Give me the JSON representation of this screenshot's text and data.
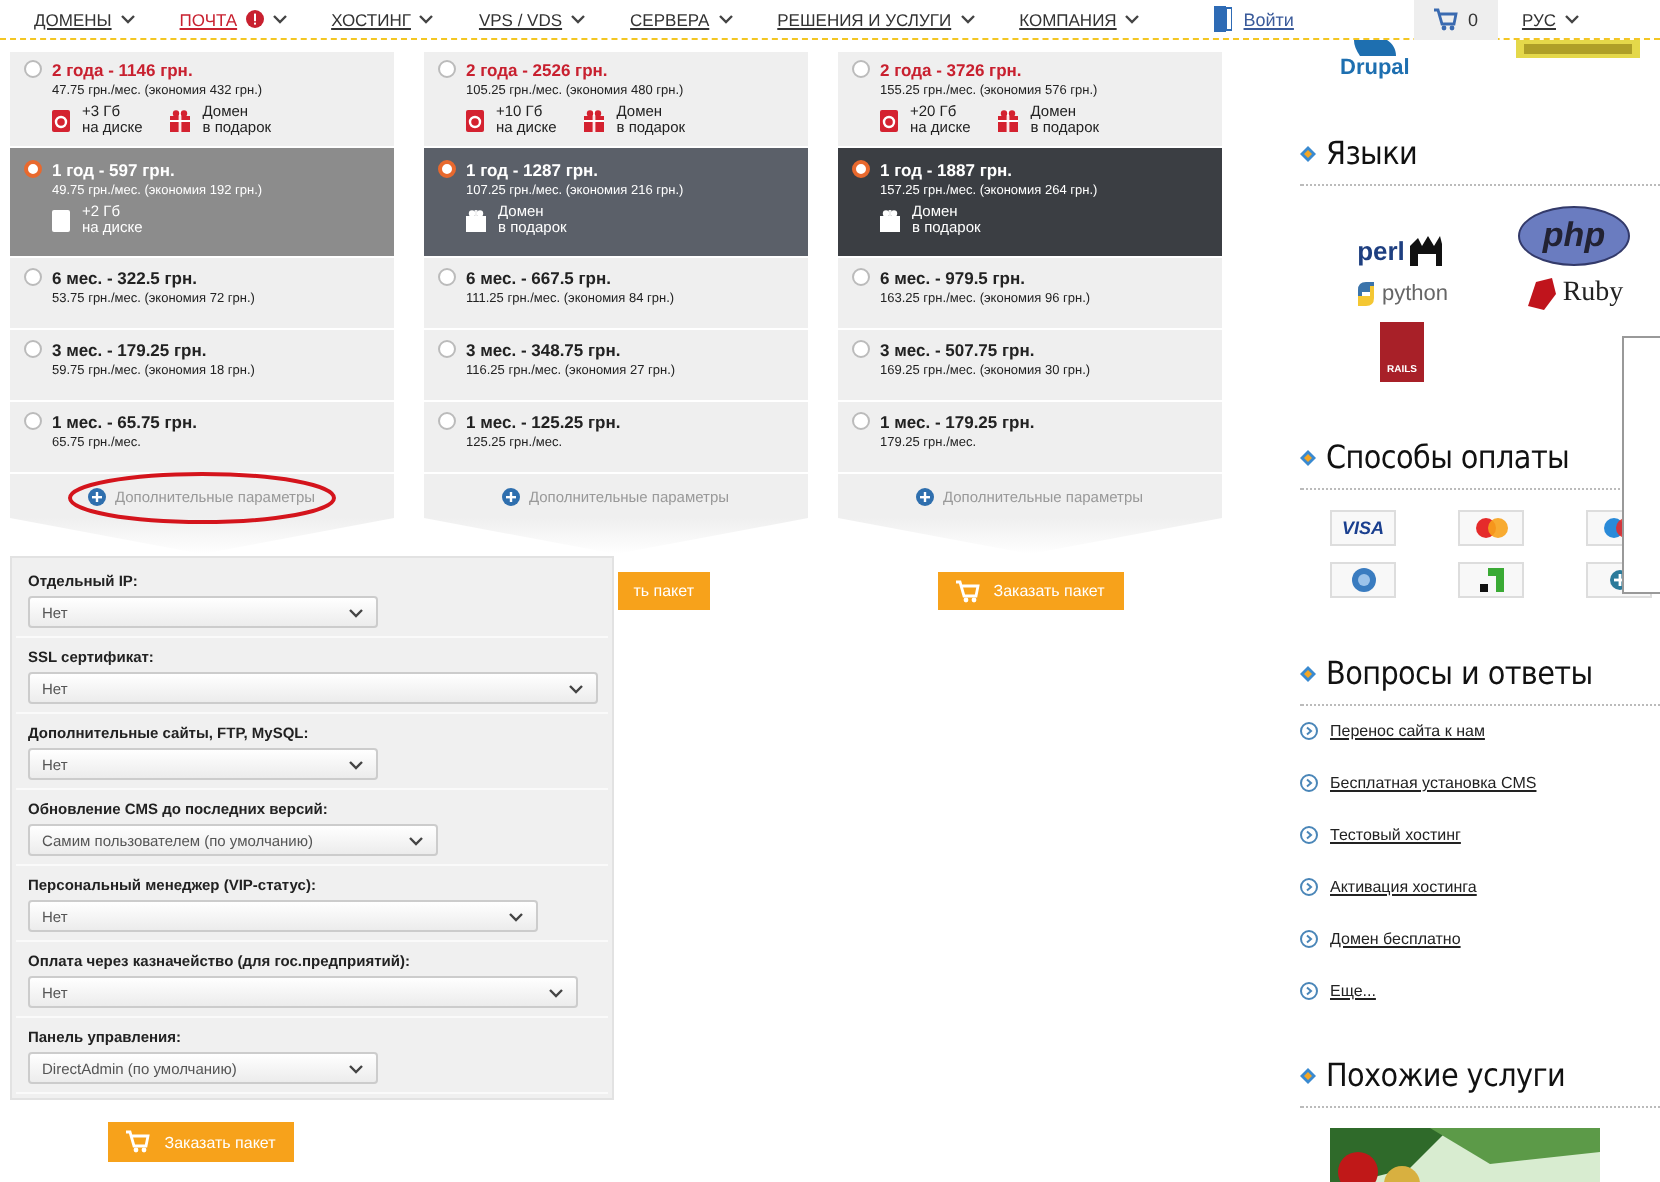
{
  "nav": {
    "items": [
      {
        "label": "ДОМЕНЫ",
        "alert": false
      },
      {
        "label": "ПОЧТА",
        "alert": true
      },
      {
        "label": "ХОСТИНГ",
        "alert": false
      },
      {
        "label": "VPS / VDS",
        "alert": false
      },
      {
        "label": "СЕРВЕРА",
        "alert": false
      },
      {
        "label": "РЕШЕНИЯ И УСЛУГИ",
        "alert": false
      },
      {
        "label": "КОМПАНИЯ",
        "alert": false
      }
    ],
    "login": "Войти",
    "cart_count": "0",
    "language": "РУС"
  },
  "plans": [
    {
      "color": "#8c8c8c",
      "more": "Дополнительные параметры",
      "options": [
        {
          "title": "2 года - 1146 грн.",
          "accent": true,
          "selected": false,
          "price": "47.75 грн./мес. (экономия 432 грн.)",
          "perks": [
            {
              "kind": "disk",
              "value": "+3 Гб",
              "caption": "на диске"
            },
            {
              "kind": "gift",
              "value": "Домен",
              "caption": "в подарок"
            }
          ]
        },
        {
          "title": "1 год - 597 грн.",
          "accent": false,
          "selected": true,
          "price": "49.75 грн./мес. (экономия 192 грн.)",
          "perks": [
            {
              "kind": "disk",
              "value": "+2 Гб",
              "caption": "на диске"
            }
          ]
        },
        {
          "title": "6 мес. - 322.5 грн.",
          "accent": false,
          "selected": false,
          "price": "53.75 грн./мес. (экономия 72 грн.)"
        },
        {
          "title": "3 мес. - 179.25 грн.",
          "accent": false,
          "selected": false,
          "price": "59.75 грн./мес. (экономия 18 грн.)"
        },
        {
          "title": "1 мес. - 65.75 грн.",
          "accent": false,
          "selected": false,
          "price": "65.75 грн./мес."
        }
      ]
    },
    {
      "color": "#5b6069",
      "more": "Дополнительные параметры",
      "order": "ть пакет",
      "options": [
        {
          "title": "2 года - 2526 грн.",
          "accent": true,
          "selected": false,
          "price": "105.25 грн./мес. (экономия 480 грн.)",
          "perks": [
            {
              "kind": "disk",
              "value": "+10 Гб",
              "caption": "на диске"
            },
            {
              "kind": "gift",
              "value": "Домен",
              "caption": "в подарок"
            }
          ]
        },
        {
          "title": "1 год - 1287 грн.",
          "accent": false,
          "selected": true,
          "price": "107.25 грн./мес. (экономия 216 грн.)",
          "perks": [
            {
              "kind": "gift",
              "value": "Домен",
              "caption": "в подарок"
            }
          ]
        },
        {
          "title": "6 мес. - 667.5 грн.",
          "accent": false,
          "selected": false,
          "price": "111.25 грн./мес. (экономия 84 грн.)"
        },
        {
          "title": "3 мес. - 348.75 грн.",
          "accent": false,
          "selected": false,
          "price": "116.25 грн./мес. (экономия 27 грн.)"
        },
        {
          "title": "1 мес. - 125.25 грн.",
          "accent": false,
          "selected": false,
          "price": "125.25 грн./мес."
        }
      ]
    },
    {
      "color": "#3b3e43",
      "more": "Дополнительные параметры",
      "order": "Заказать пакет",
      "options": [
        {
          "title": "2 года - 3726 грн.",
          "accent": true,
          "selected": false,
          "price": "155.25 грн./мес. (экономия 576 грн.)",
          "perks": [
            {
              "kind": "disk",
              "value": "+20 Гб",
              "caption": "на диске"
            },
            {
              "kind": "gift",
              "value": "Домен",
              "caption": "в подарок"
            }
          ]
        },
        {
          "title": "1 год - 1887 грн.",
          "accent": false,
          "selected": true,
          "price": "157.25 грн./мес. (экономия 264 грн.)",
          "perks": [
            {
              "kind": "gift",
              "value": "Домен",
              "caption": "в подарок"
            }
          ]
        },
        {
          "title": "6 мес. - 979.5 грн.",
          "accent": false,
          "selected": false,
          "price": "163.25 грн./мес. (экономия 96 грн.)"
        },
        {
          "title": "3 мес. - 507.75 грн.",
          "accent": false,
          "selected": false,
          "price": "169.25 грн./мес. (экономия 30 грн.)"
        },
        {
          "title": "1 мес. - 179.25 грн.",
          "accent": false,
          "selected": false,
          "price": "179.25 грн./мес."
        }
      ]
    }
  ],
  "extra_options": {
    "fields": [
      {
        "label": "Отдельный IP:",
        "value": "Нет"
      },
      {
        "label": "SSL сертификат:",
        "value": "Нет"
      },
      {
        "label": "Дополнительные сайты, FTP, MySQL:",
        "value": "Нет"
      },
      {
        "label": "Обновление CMS до последних версий:",
        "value": "Самим пользователем (по умолчанию)"
      },
      {
        "label": "Персональный менеджер (VIP-статус):",
        "value": "Нет"
      },
      {
        "label": "Оплата через казначейство (для гос.предприятий):",
        "value": "Нет"
      },
      {
        "label": "Панель управления:",
        "value": "DirectAdmin (по умолчанию)"
      }
    ],
    "order": "Заказать пакет"
  },
  "sidebar": {
    "cms_logo": "Drupal",
    "languages": {
      "title": "Языки",
      "logos": [
        "perl",
        "php",
        "python",
        "Ruby"
      ],
      "rails": "RAILS"
    },
    "payments": {
      "title": "Способы оплаты",
      "visa": "VISA"
    },
    "faq": {
      "title": "Вопросы и ответы",
      "links": [
        "Перенос сайта к нам",
        "Бесплатная установка CMS",
        "Тестовый хостинг",
        "Активация хостинга",
        "Домен бесплатно",
        "Еще..."
      ]
    },
    "related": {
      "title": "Похожие услуги"
    }
  }
}
